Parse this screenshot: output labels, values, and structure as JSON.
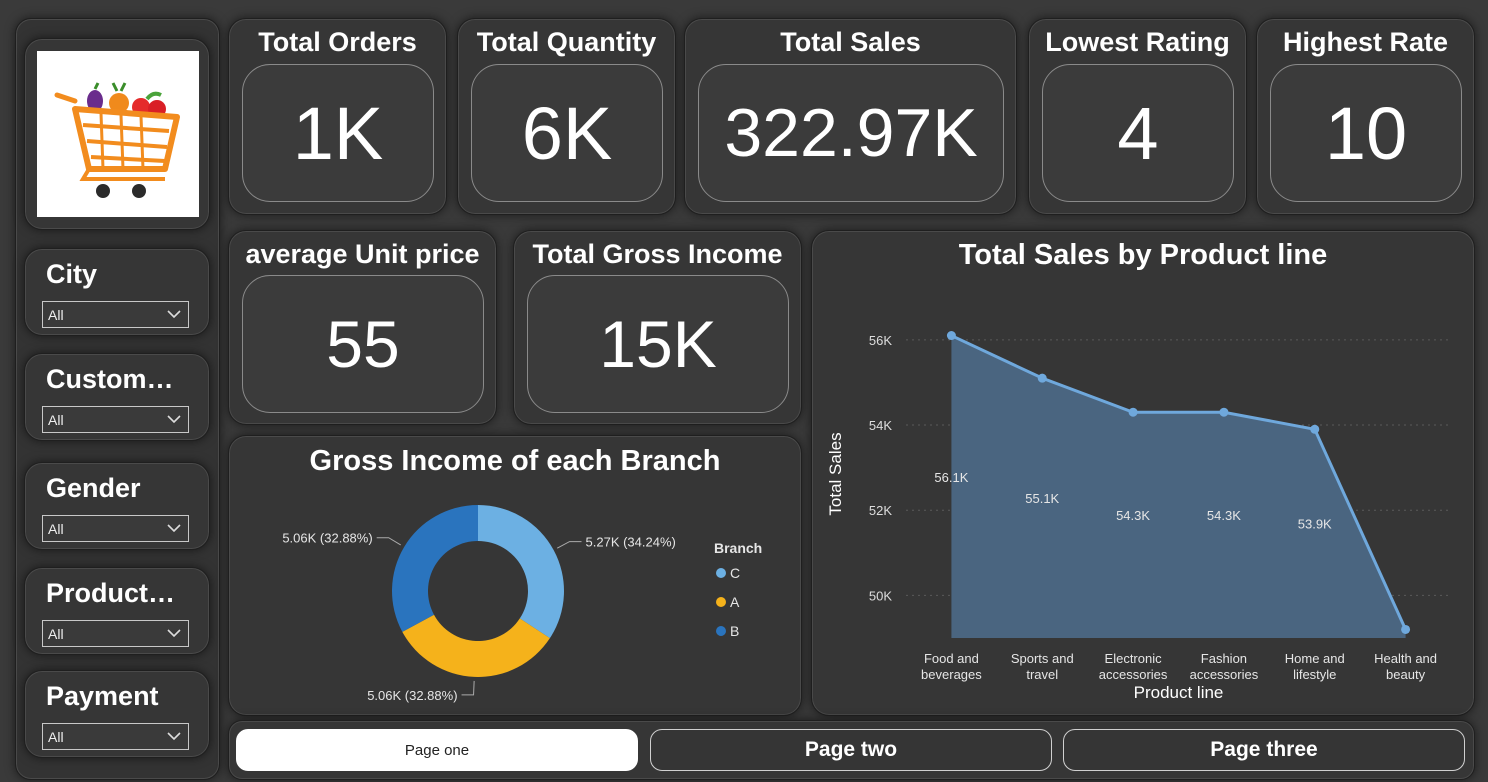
{
  "slicers": [
    {
      "title": "City",
      "value": "All"
    },
    {
      "title": "Custom…",
      "value": "All"
    },
    {
      "title": "Gender",
      "value": "All"
    },
    {
      "title": "Product…",
      "value": "All"
    },
    {
      "title": "Payment",
      "value": "All"
    }
  ],
  "kpis": {
    "total_orders": {
      "title": "Total Orders",
      "value": "1K"
    },
    "total_quantity": {
      "title": "Total Quantity",
      "value": "6K"
    },
    "total_sales": {
      "title": "Total Sales",
      "value": "322.97K"
    },
    "lowest_rating": {
      "title": "Lowest Rating",
      "value": "4"
    },
    "highest_rate": {
      "title": "Highest Rate",
      "value": "10"
    },
    "avg_unit_price": {
      "title": "average Unit price",
      "value": "55"
    },
    "total_gross_income": {
      "title": "Total Gross Income",
      "value": "15K"
    }
  },
  "chart_data": [
    {
      "type": "area",
      "title": "Total Sales by Product line",
      "xlabel": "Product line",
      "ylabel": "Total Sales",
      "categories": [
        [
          "Food and",
          "beverages"
        ],
        [
          "Sports and",
          "travel"
        ],
        [
          "Electronic",
          "accessories"
        ],
        [
          "Fashion",
          "accessories"
        ],
        [
          "Home and",
          "lifestyle"
        ],
        [
          "Health and",
          "beauty"
        ]
      ],
      "values": [
        56100,
        55100,
        54300,
        54300,
        53900,
        49200
      ],
      "data_labels": [
        "56.1K",
        "55.1K",
        "54.3K",
        "54.3K",
        "53.9K",
        ""
      ],
      "yticks": [
        {
          "v": 50000,
          "label": "50K"
        },
        {
          "v": 52000,
          "label": "52K"
        },
        {
          "v": 54000,
          "label": "54K"
        },
        {
          "v": 56000,
          "label": "56K"
        }
      ],
      "ylim": [
        49000,
        56700
      ],
      "grid": true,
      "color": "#6fa8dc",
      "fill": "#4a6580"
    },
    {
      "type": "pie",
      "title": "Gross Income of each Branch",
      "legend_title": "Branch",
      "legend_position": "right",
      "slices": [
        {
          "name": "C",
          "value": 5.27,
          "label": "5.27K (34.24%)",
          "color": "#6cb0e3"
        },
        {
          "name": "A",
          "value": 5.06,
          "label": "5.06K (32.88%)",
          "color": "#f5b21b"
        },
        {
          "name": "B",
          "value": 5.06,
          "label": "5.06K (32.88%)",
          "color": "#2a74be"
        }
      ]
    }
  ],
  "nav": {
    "page_one": "Page one",
    "page_two": "Page two",
    "page_three": "Page three"
  }
}
